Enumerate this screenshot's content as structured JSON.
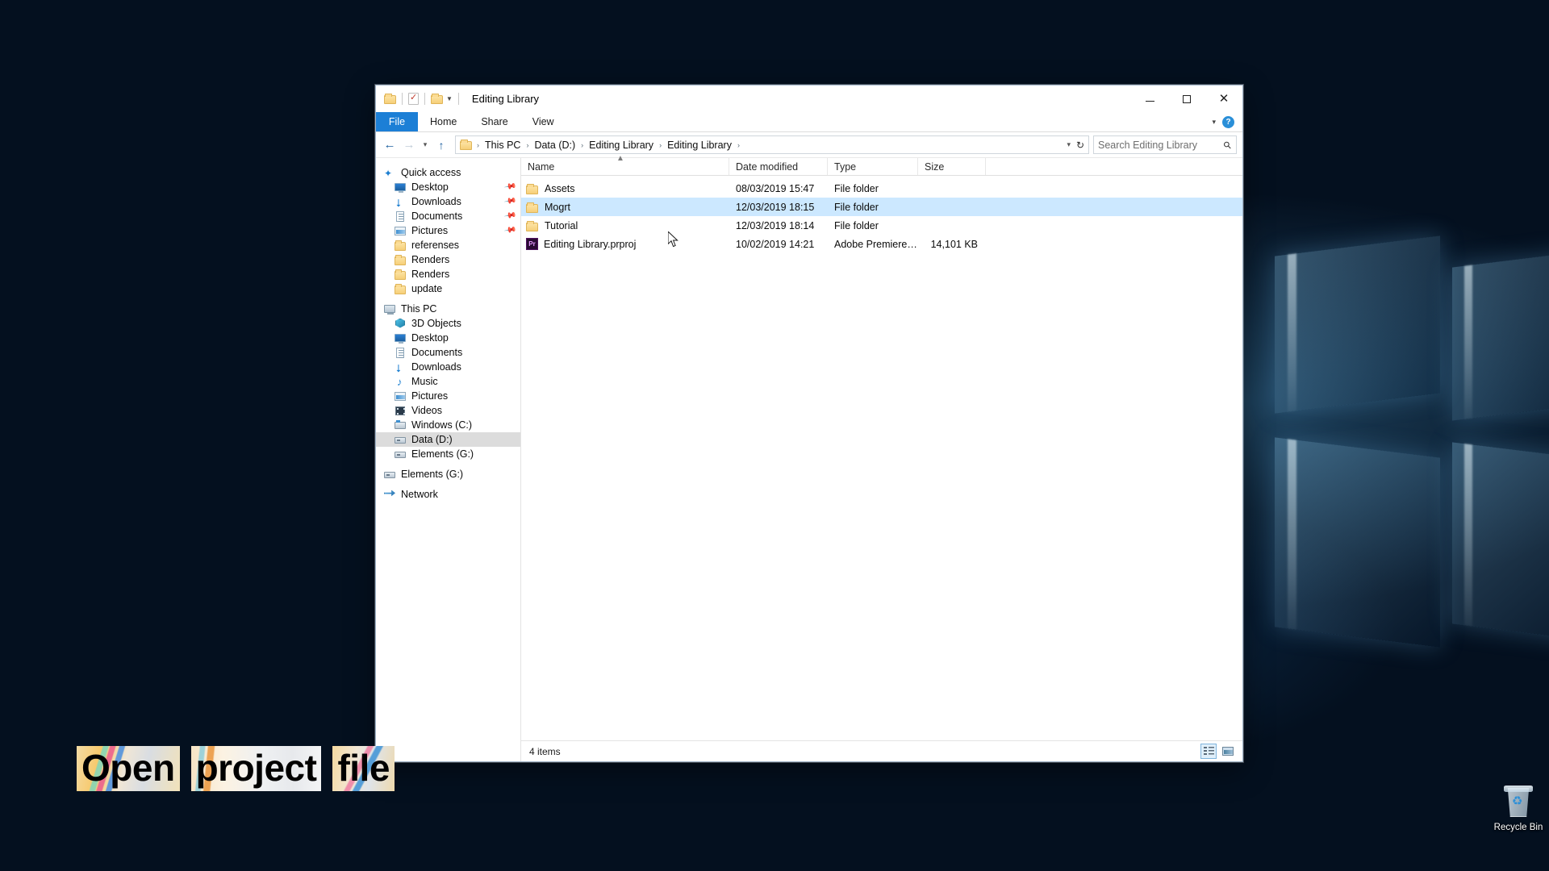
{
  "desktop": {
    "recycle_bin": {
      "label": "Recycle Bin",
      "icon": "recycle-bin-icon"
    }
  },
  "overlay": {
    "tokens": [
      "Open",
      "project",
      "file"
    ]
  },
  "window": {
    "title": "Editing Library",
    "quick_access_toolbar": [
      {
        "icon": "folder-icon",
        "name": "save-folder"
      },
      {
        "icon": "properties-icon",
        "name": "properties"
      },
      {
        "icon": "folder-icon",
        "name": "new-folder"
      },
      {
        "icon": "chevron-down-icon",
        "name": "customize-qat"
      }
    ],
    "controls": {
      "minimize": "—",
      "maximize": "☐",
      "close": "✕"
    },
    "ribbon": {
      "tabs": [
        {
          "label": "File",
          "active": true
        },
        {
          "label": "Home",
          "active": false
        },
        {
          "label": "Share",
          "active": false
        },
        {
          "label": "View",
          "active": false
        }
      ],
      "collapse_icon": "chevron-down-icon",
      "help_label": "?"
    },
    "address": {
      "back_icon": "arrow-left-icon",
      "forward_icon": "arrow-right-icon",
      "recent_icon": "chevron-down-icon",
      "up_icon": "arrow-up-icon",
      "breadcrumbs": [
        "This PC",
        "Data (D:)",
        "Editing Library",
        "Editing Library"
      ],
      "separator": "›",
      "dropdown_icon": "chevron-down-icon",
      "refresh_icon": "refresh-icon"
    },
    "search": {
      "placeholder": "Search Editing Library",
      "value": "",
      "icon": "search-icon"
    },
    "nav_pane": {
      "sections": [
        {
          "header": {
            "label": "Quick access",
            "icon": "star-pin-icon",
            "level": 0
          },
          "items": [
            {
              "label": "Desktop",
              "icon": "monitor-icon",
              "pinned": true,
              "level": 1
            },
            {
              "label": "Downloads",
              "icon": "download-icon",
              "pinned": true,
              "level": 1
            },
            {
              "label": "Documents",
              "icon": "document-icon",
              "pinned": true,
              "level": 1
            },
            {
              "label": "Pictures",
              "icon": "picture-icon",
              "pinned": true,
              "level": 1
            },
            {
              "label": "referenses",
              "icon": "folder-icon",
              "pinned": false,
              "level": 1
            },
            {
              "label": "Renders",
              "icon": "folder-icon",
              "pinned": false,
              "level": 1
            },
            {
              "label": "Renders",
              "icon": "folder-icon",
              "pinned": false,
              "level": 1
            },
            {
              "label": "update",
              "icon": "folder-icon",
              "pinned": false,
              "level": 1
            }
          ]
        },
        {
          "header": {
            "label": "This PC",
            "icon": "this-pc-icon",
            "level": 0
          },
          "items": [
            {
              "label": "3D Objects",
              "icon": "3d-objects-icon",
              "level": 1,
              "selected": false
            },
            {
              "label": "Desktop",
              "icon": "monitor-icon",
              "level": 1,
              "selected": false
            },
            {
              "label": "Documents",
              "icon": "document-icon",
              "level": 1,
              "selected": false
            },
            {
              "label": "Downloads",
              "icon": "download-icon",
              "level": 1,
              "selected": false
            },
            {
              "label": "Music",
              "icon": "music-icon",
              "level": 1,
              "selected": false
            },
            {
              "label": "Pictures",
              "icon": "picture-icon",
              "level": 1,
              "selected": false
            },
            {
              "label": "Videos",
              "icon": "video-icon",
              "level": 1,
              "selected": false
            },
            {
              "label": "Windows (C:)",
              "icon": "system-drive-icon",
              "level": 1,
              "selected": false
            },
            {
              "label": "Data (D:)",
              "icon": "drive-icon",
              "level": 1,
              "selected": true
            },
            {
              "label": "Elements (G:)",
              "icon": "drive-icon",
              "level": 1,
              "selected": false
            }
          ]
        },
        {
          "header": {
            "label": "Elements (G:)",
            "icon": "drive-icon",
            "level": 0
          },
          "items": []
        },
        {
          "header": {
            "label": "Network",
            "icon": "network-icon",
            "level": 0
          },
          "items": []
        }
      ]
    },
    "file_list": {
      "columns": [
        {
          "key": "name",
          "label": "Name",
          "sorted": true,
          "sort_icon": "chevron-up-icon"
        },
        {
          "key": "date",
          "label": "Date modified"
        },
        {
          "key": "type",
          "label": "Type"
        },
        {
          "key": "size",
          "label": "Size"
        }
      ],
      "rows": [
        {
          "name": "Assets",
          "date": "08/03/2019 15:47",
          "type": "File folder",
          "size": "",
          "icon": "folder-icon",
          "selected": false
        },
        {
          "name": "Mogrt",
          "date": "12/03/2019 18:15",
          "type": "File folder",
          "size": "",
          "icon": "folder-icon",
          "selected": true
        },
        {
          "name": "Tutorial",
          "date": "12/03/2019 18:14",
          "type": "File folder",
          "size": "",
          "icon": "folder-icon",
          "selected": false
        },
        {
          "name": "Editing Library.prproj",
          "date": "10/02/2019 14:21",
          "type": "Adobe Premiere P...",
          "size": "14,101 KB",
          "icon": "premiere-project-icon",
          "selected": false
        }
      ]
    },
    "status_bar": {
      "item_count": "4 items",
      "views": [
        {
          "name": "details-view-button",
          "icon": "details-view-icon",
          "active": true
        },
        {
          "name": "large-icons-view-button",
          "icon": "large-icons-view-icon",
          "active": false
        }
      ]
    }
  },
  "colors": {
    "accent": "#1c7fd6",
    "selection": "#cce8ff",
    "nav_selection": "#dcdcdc",
    "folder_yellow": "#f6cf79",
    "premiere_purple": "#2a0a33",
    "desktop_blue": "#04101f"
  }
}
